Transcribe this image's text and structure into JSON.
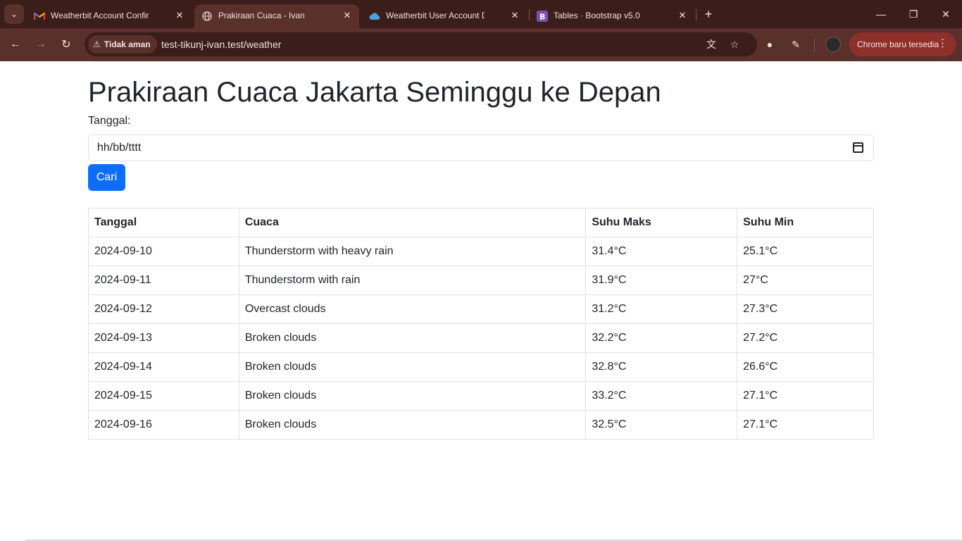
{
  "browser": {
    "tabs": [
      {
        "title": "Weatherbit Account Confirmati",
        "icon": "gmail-icon",
        "active": false
      },
      {
        "title": "Prakiraan Cuaca - Ivan",
        "icon": "globe-icon",
        "active": true
      },
      {
        "title": "Weatherbit User Account Dashb",
        "icon": "weatherbit-icon",
        "active": false
      },
      {
        "title": "Tables · Bootstrap v5.0",
        "icon": "bootstrap-icon",
        "active": false
      }
    ],
    "security_label": "Tidak aman",
    "url": "test-tikunj-ivan.test/weather",
    "update_label": "Chrome baru tersedia",
    "colors": {
      "frame": "#3b1d1a",
      "toolbar": "#5a302a",
      "update_chip": "#8e2f29"
    }
  },
  "page": {
    "title": "Prakiraan Cuaca Jakarta Seminggu ke Depan",
    "date_label": "Tanggal:",
    "date_placeholder": "hh/bb/tttt",
    "search_button": "Cari",
    "primary_color": "#0d6efd",
    "table": {
      "headers": [
        "Tanggal",
        "Cuaca",
        "Suhu Maks",
        "Suhu Min"
      ],
      "rows": [
        [
          "2024-09-10",
          "Thunderstorm with heavy rain",
          "31.4°C",
          "25.1°C"
        ],
        [
          "2024-09-11",
          "Thunderstorm with rain",
          "31.9°C",
          "27°C"
        ],
        [
          "2024-09-12",
          "Overcast clouds",
          "31.2°C",
          "27.3°C"
        ],
        [
          "2024-09-13",
          "Broken clouds",
          "32.2°C",
          "27.2°C"
        ],
        [
          "2024-09-14",
          "Broken clouds",
          "32.8°C",
          "26.6°C"
        ],
        [
          "2024-09-15",
          "Broken clouds",
          "33.2°C",
          "27.1°C"
        ],
        [
          "2024-09-16",
          "Broken clouds",
          "32.5°C",
          "27.1°C"
        ]
      ]
    }
  }
}
